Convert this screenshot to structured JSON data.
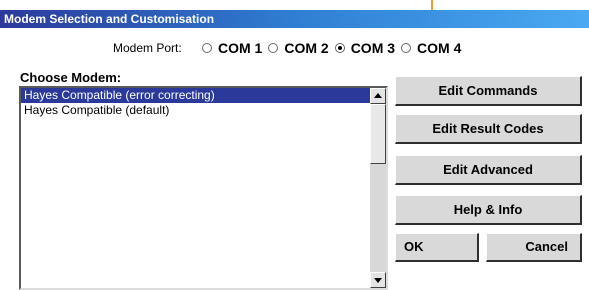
{
  "window": {
    "title": "Modem Selection and Customisation"
  },
  "modem_port": {
    "label": "Modem Port:",
    "options": [
      "COM 1",
      "COM 2",
      "COM 3",
      "COM 4"
    ],
    "selected": "COM 3"
  },
  "modem_list": {
    "label": "Choose Modem:",
    "items": [
      "Hayes Compatible (error correcting)",
      "Hayes Compatible (default)"
    ],
    "selected": "Hayes Compatible (error correcting)"
  },
  "buttons": {
    "edit_commands": "Edit Commands",
    "edit_result_codes": "Edit Result Codes",
    "edit_advanced": "Edit Advanced",
    "help_info": "Help & Info",
    "ok": "OK",
    "cancel": "Cancel"
  },
  "colors": {
    "title_gradient_start": "#2b3a9a",
    "title_gradient_end": "#4aa9f2",
    "selection": "#2b3a9a",
    "accent_mark": "#f29a2e"
  }
}
